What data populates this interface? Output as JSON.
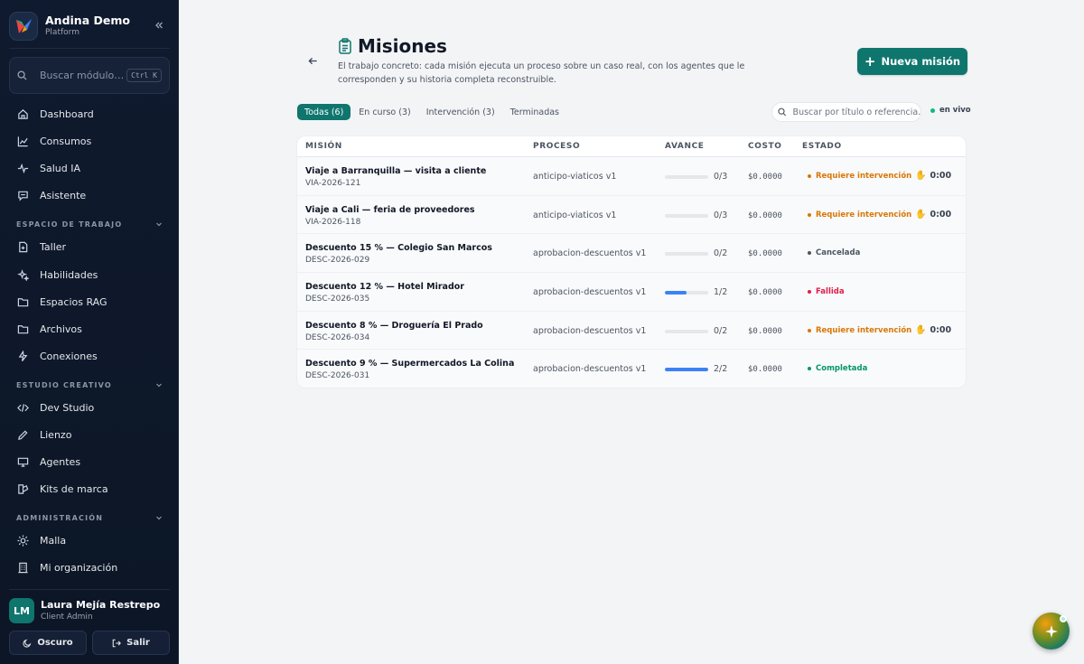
{
  "brand": {
    "name": "Andina Demo",
    "subtitle": "Platform"
  },
  "search": {
    "placeholder": "Buscar módulo…",
    "shortcut": "Ctrl K"
  },
  "nav_main": [
    {
      "label": "Dashboard",
      "icon": "home-icon"
    },
    {
      "label": "Consumos",
      "icon": "line-chart-icon"
    },
    {
      "label": "Salud IA",
      "icon": "pulse-icon"
    },
    {
      "label": "Asistente",
      "icon": "chat-icon"
    }
  ],
  "sections": {
    "workspace": {
      "title": "ESPACIO DE TRABAJO",
      "items": [
        {
          "label": "Taller",
          "icon": "file-plus-icon"
        },
        {
          "label": "Habilidades",
          "icon": "sparkles-icon"
        },
        {
          "label": "Espacios RAG",
          "icon": "folder-icon"
        },
        {
          "label": "Archivos",
          "icon": "folder-icon"
        },
        {
          "label": "Conexiones",
          "icon": "plug-icon"
        }
      ]
    },
    "studio": {
      "title": "ESTUDIO CREATIVO",
      "items": [
        {
          "label": "Dev Studio",
          "icon": "code-icon"
        },
        {
          "label": "Lienzo",
          "icon": "pencil-icon"
        },
        {
          "label": "Agentes",
          "icon": "monitor-icon"
        },
        {
          "label": "Kits de marca",
          "icon": "palette-icon"
        }
      ]
    },
    "admin": {
      "title": "ADMINISTRACIÓN",
      "items": [
        {
          "label": "Malla",
          "icon": "sun-icon"
        },
        {
          "label": "Mi organización",
          "icon": "building-icon"
        }
      ]
    }
  },
  "user": {
    "initials": "LM",
    "name": "Laura Mejía Restrepo",
    "role": "Client Admin"
  },
  "footer": {
    "theme_label": "Oscuro",
    "logout_label": "Salir"
  },
  "page": {
    "title": "Misiones",
    "description": "El trabajo concreto: cada misión ejecuta un proceso sobre un caso real, con los agentes que le corresponden y su historia completa reconstruible.",
    "new_button": "Nueva misión"
  },
  "tabs": [
    {
      "label": "Todas (6)",
      "active": true
    },
    {
      "label": "En curso (3)",
      "active": false
    },
    {
      "label": "Intervención (3)",
      "active": false
    },
    {
      "label": "Terminadas",
      "active": false
    }
  ],
  "filter": {
    "placeholder": "Buscar por título o referencia…"
  },
  "live_label": "en vivo",
  "table": {
    "headers": [
      "MISIÓN",
      "PROCESO",
      "AVANCE",
      "COSTO",
      "ESTADO"
    ],
    "rows": [
      {
        "title": "Viaje a Barranquilla — visita a cliente",
        "ref": "VIA-2026-121",
        "process": "anticipo-viaticos v1",
        "progress": "0/3",
        "progress_value": 0,
        "cost": "$0.0000",
        "status": "Requiere intervención",
        "status_color": "#d97706",
        "timer": "0:00"
      },
      {
        "title": "Viaje a Cali — feria de proveedores",
        "ref": "VIA-2026-118",
        "process": "anticipo-viaticos v1",
        "progress": "0/3",
        "progress_value": 0,
        "cost": "$0.0000",
        "status": "Requiere intervención",
        "status_color": "#d97706",
        "timer": "0:00"
      },
      {
        "title": "Descuento 15 % — Colegio San Marcos",
        "ref": "DESC-2026-029",
        "process": "aprobacion-descuentos v1",
        "progress": "0/2",
        "progress_value": 0,
        "cost": "$0.0000",
        "status": "Cancelada",
        "status_color": "#4b5563",
        "timer": ""
      },
      {
        "title": "Descuento 12 % — Hotel Mirador",
        "ref": "DESC-2026-035",
        "process": "aprobacion-descuentos v1",
        "progress": "1/2",
        "progress_value": 0.5,
        "cost": "$0.0000",
        "status": "Fallida",
        "status_color": "#e11d48",
        "timer": ""
      },
      {
        "title": "Descuento 8 % — Droguería El Prado",
        "ref": "DESC-2026-034",
        "process": "aprobacion-descuentos v1",
        "progress": "0/2",
        "progress_value": 0,
        "cost": "$0.0000",
        "status": "Requiere intervención",
        "status_color": "#d97706",
        "timer": "0:00"
      },
      {
        "title": "Descuento 9 % — Supermercados La Colina",
        "ref": "DESC-2026-031",
        "process": "aprobacion-descuentos v1",
        "progress": "2/2",
        "progress_value": 1,
        "cost": "$0.0000",
        "status": "Completada",
        "status_color": "#059669",
        "timer": ""
      }
    ]
  },
  "colors": {
    "accent": "#0f766e",
    "sidebar_bg": "#0f1a2e",
    "progress": "#3b82f6",
    "live": "#10b981"
  }
}
